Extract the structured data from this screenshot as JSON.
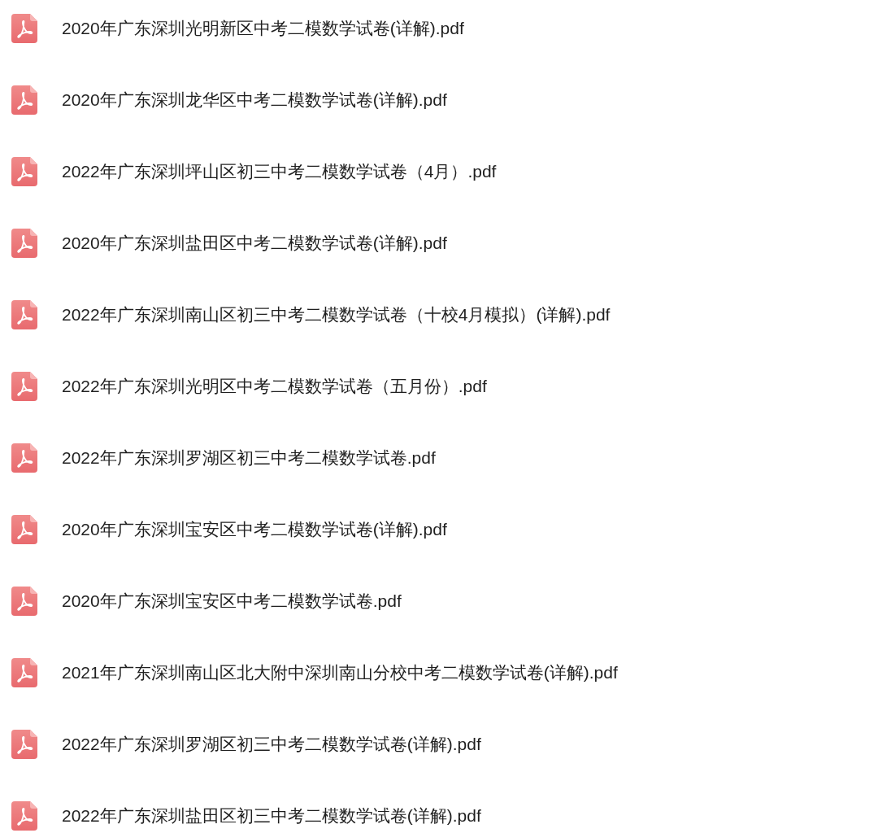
{
  "files": [
    {
      "name": "2020年广东深圳光明新区中考二模数学试卷(详解).pdf",
      "kind": "pdf"
    },
    {
      "name": "2020年广东深圳龙华区中考二模数学试卷(详解).pdf",
      "kind": "pdf"
    },
    {
      "name": "2022年广东深圳坪山区初三中考二模数学试卷（4月）.pdf",
      "kind": "pdf"
    },
    {
      "name": "2020年广东深圳盐田区中考二模数学试卷(详解).pdf",
      "kind": "pdf"
    },
    {
      "name": "2022年广东深圳南山区初三中考二模数学试卷（十校4月模拟）(详解).pdf",
      "kind": "pdf"
    },
    {
      "name": "2022年广东深圳光明区中考二模数学试卷（五月份）.pdf",
      "kind": "pdf"
    },
    {
      "name": "2022年广东深圳罗湖区初三中考二模数学试卷.pdf",
      "kind": "pdf"
    },
    {
      "name": "2020年广东深圳宝安区中考二模数学试卷(详解).pdf",
      "kind": "pdf"
    },
    {
      "name": "2020年广东深圳宝安区中考二模数学试卷.pdf",
      "kind": "pdf"
    },
    {
      "name": "2021年广东深圳南山区北大附中深圳南山分校中考二模数学试卷(详解).pdf",
      "kind": "pdf"
    },
    {
      "name": "2022年广东深圳罗湖区初三中考二模数学试卷(详解).pdf",
      "kind": "pdf"
    },
    {
      "name": "2022年广东深圳盐田区初三中考二模数学试卷(详解).pdf",
      "kind": "pdf"
    }
  ]
}
